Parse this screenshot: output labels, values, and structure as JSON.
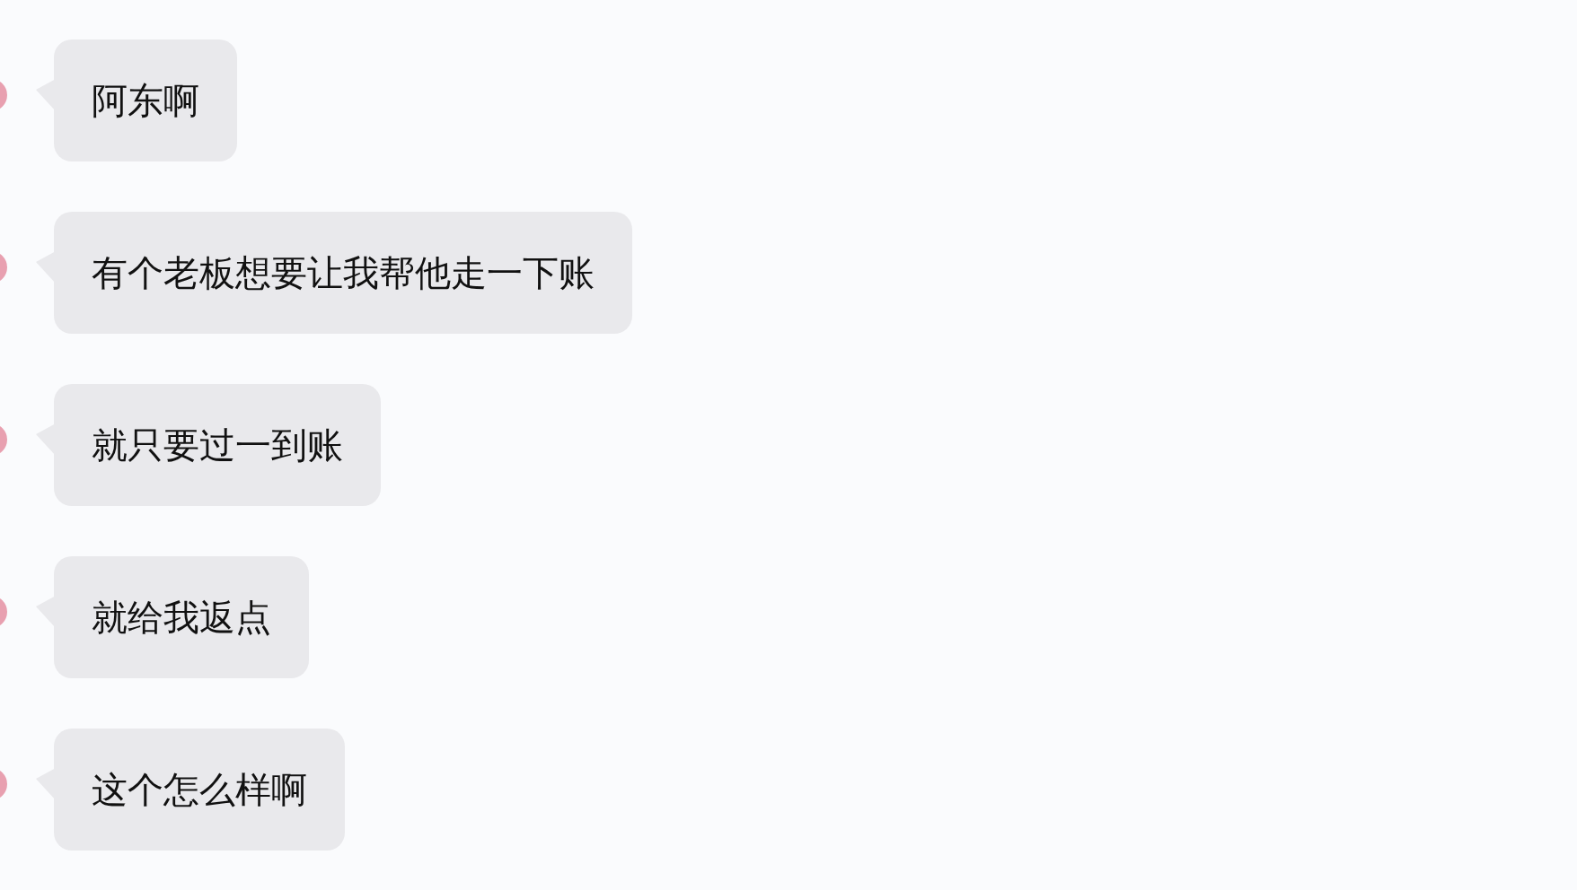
{
  "messages": [
    {
      "text": "阿东啊"
    },
    {
      "text": "有个老板想要让我帮他走一下账"
    },
    {
      "text": "就只要过一到账"
    },
    {
      "text": "就给我返点"
    },
    {
      "text": "这个怎么样啊"
    }
  ]
}
